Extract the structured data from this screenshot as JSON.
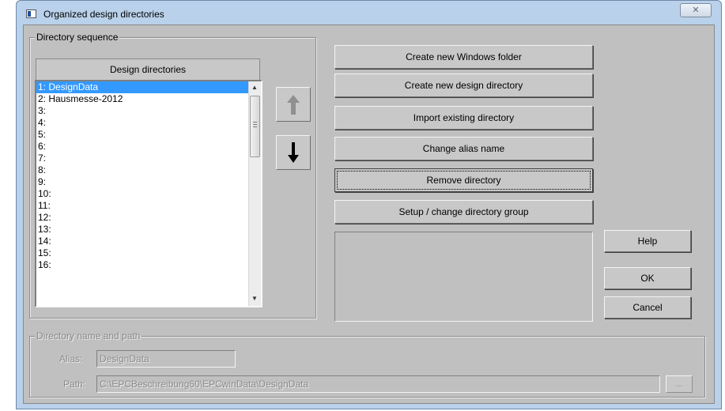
{
  "window": {
    "title": "Organized design directories",
    "close_glyph": "✕"
  },
  "sequence_group": {
    "title": "Directory sequence",
    "list_header": "Design directories",
    "items": [
      {
        "label": "1: DesignData",
        "selected": true
      },
      {
        "label": "2: Hausmesse-2012",
        "selected": false
      },
      {
        "label": "3:",
        "selected": false
      },
      {
        "label": "4:",
        "selected": false
      },
      {
        "label": "5:",
        "selected": false
      },
      {
        "label": "6:",
        "selected": false
      },
      {
        "label": "7:",
        "selected": false
      },
      {
        "label": "8:",
        "selected": false
      },
      {
        "label": "9:",
        "selected": false
      },
      {
        "label": "10:",
        "selected": false
      },
      {
        "label": "11:",
        "selected": false
      },
      {
        "label": "12:",
        "selected": false
      },
      {
        "label": "13:",
        "selected": false
      },
      {
        "label": "14:",
        "selected": false
      },
      {
        "label": "15:",
        "selected": false
      },
      {
        "label": "16:",
        "selected": false
      }
    ],
    "move_up_icon": "arrow-up-icon",
    "move_down_icon": "arrow-down-icon"
  },
  "actions": {
    "create_windows_folder": "Create new Windows folder",
    "create_design_directory": "Create new design directory",
    "import_existing": "Import existing directory",
    "change_alias": "Change alias name",
    "remove_directory": "Remove directory",
    "setup_group": "Setup / change directory group"
  },
  "dialog_buttons": {
    "help": "Help",
    "ok": "OK",
    "cancel": "Cancel"
  },
  "name_path_group": {
    "title": "Directory name and path",
    "alias_label": "Alias:",
    "alias_value": "DesignData",
    "path_label": "Path:",
    "path_value": "C:\\EPCBeschreibung60\\EPCwinData\\DesignData",
    "browse_label": "..."
  },
  "colors": {
    "selection": "#3399ff",
    "dialog_face": "#c0c0c0",
    "frame": "#b9d1ea",
    "disabled_text": "#8a8a8a"
  }
}
